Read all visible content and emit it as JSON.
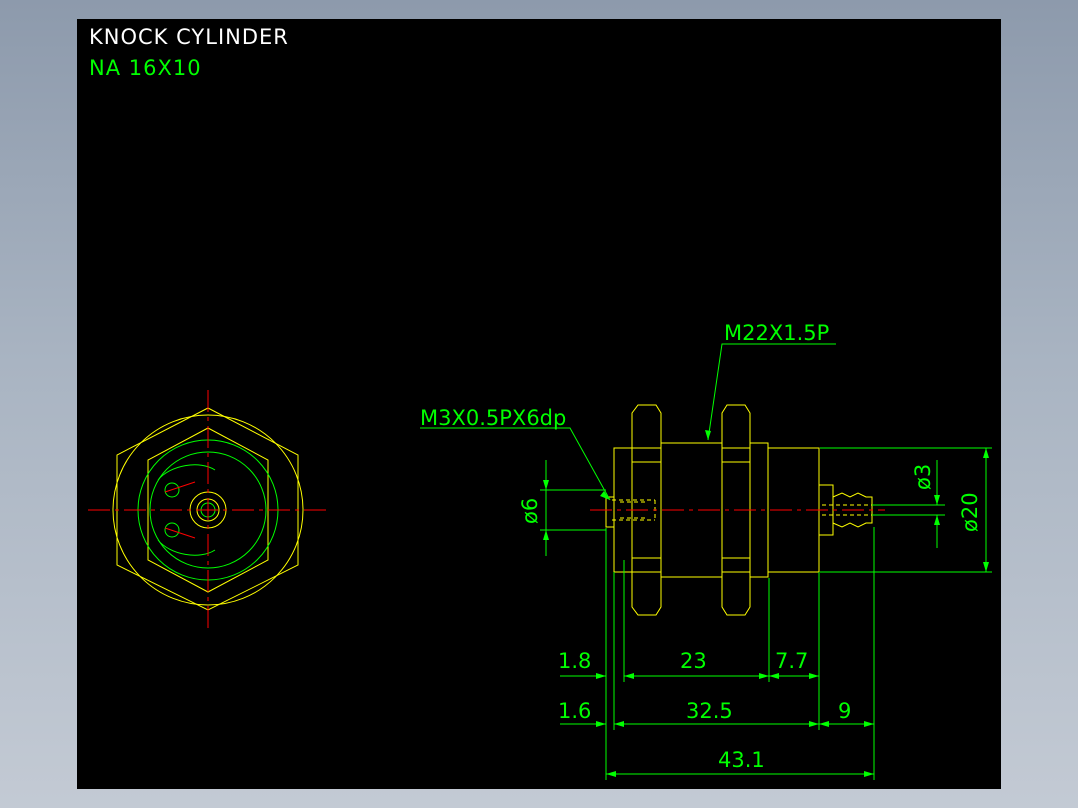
{
  "titles": {
    "name": "KNOCK CYLINDER",
    "model": "NA 16X10"
  },
  "callouts": {
    "thread_main": "M22X1.5P",
    "thread_rod": "M3X0.5PX6dp"
  },
  "dimensions": {
    "rod_dia": "ø6",
    "port_dia": "ø3",
    "body_dia": "ø20",
    "d_1_8": "1.8",
    "d_23": "23",
    "d_7_7": "7.7",
    "d_1_6": "1.6",
    "d_32_5": "32.5",
    "d_9": "9",
    "d_43_1": "43.1"
  },
  "colors": {
    "background": "#000000",
    "outline": "#ffff00",
    "dimension": "#00ff00",
    "centerline": "#ff0000",
    "title": "#ffffff",
    "subtitle": "#00ff00"
  }
}
